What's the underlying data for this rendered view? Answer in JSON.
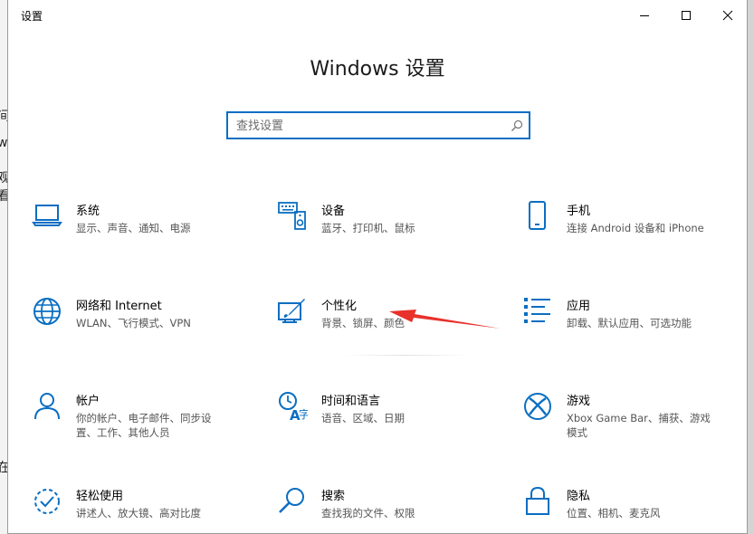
{
  "window": {
    "title": "设置",
    "minimize_glyph": "minimize-icon",
    "maximize_glyph": "maximize-icon",
    "close_glyph": "close-icon"
  },
  "page_title": "Windows 设置",
  "search": {
    "placeholder": "查找设置",
    "value": ""
  },
  "tiles": [
    {
      "title": "系统",
      "desc": "显示、声音、通知、电源",
      "icon": "laptop-icon"
    },
    {
      "title": "设备",
      "desc": "蓝牙、打印机、鼠标",
      "icon": "devices-icon"
    },
    {
      "title": "手机",
      "desc": "连接 Android 设备和 iPhone",
      "icon": "phone-icon"
    },
    {
      "title": "网络和 Internet",
      "desc": "WLAN、飞行模式、VPN",
      "icon": "globe-icon"
    },
    {
      "title": "个性化",
      "desc": "背景、锁屏、颜色",
      "icon": "personalization-icon"
    },
    {
      "title": "应用",
      "desc": "卸载、默认应用、可选功能",
      "icon": "apps-list-icon"
    },
    {
      "title": "帐户",
      "desc": "你的帐户、电子邮件、同步设置、工作、其他人员",
      "icon": "person-icon"
    },
    {
      "title": "时间和语言",
      "desc": "语音、区域、日期",
      "icon": "time-language-icon"
    },
    {
      "title": "游戏",
      "desc": "Xbox Game Bar、捕获、游戏模式",
      "icon": "xbox-icon"
    },
    {
      "title": "轻松使用",
      "desc": "讲述人、放大镜、高对比度",
      "icon": "ease-of-access-icon"
    },
    {
      "title": "搜索",
      "desc": "查找我的文件、权限",
      "icon": "search-icon"
    },
    {
      "title": "隐私",
      "desc": "位置、相机、麦克风",
      "icon": "lock-icon"
    }
  ],
  "background_fragments": [
    "间",
    "wi",
    "观",
    "看",
    "在"
  ],
  "colors": {
    "accent": "#0a6ec2",
    "annotation_arrow": "#e8312b"
  }
}
